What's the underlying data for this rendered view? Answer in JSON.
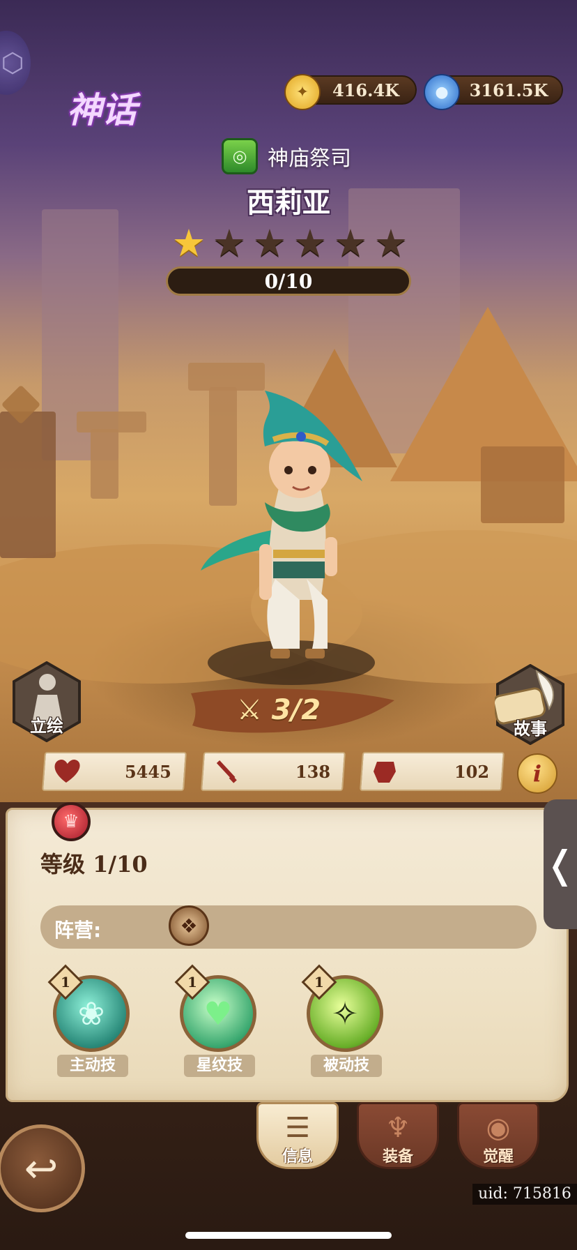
{
  "currencies": {
    "gold": {
      "value": "416.4K",
      "icon": "gold-coin-icon",
      "color": "#f2b830"
    },
    "gems": {
      "value": "3161.5K",
      "icon": "blue-potion-icon",
      "color": "#3a86e0"
    }
  },
  "hero": {
    "rarity": "神话",
    "class_name": "神庙祭司",
    "class_icon": "green-class-icon",
    "name": "西莉亚",
    "stars_filled": 1,
    "stars_total": 6,
    "shard_progress": "0/10",
    "power": "3/2"
  },
  "side_buttons": {
    "portrait_label": "立绘",
    "story_label": "故事"
  },
  "stats": {
    "hp": {
      "icon": "heart-icon",
      "value": "5445"
    },
    "attack": {
      "icon": "sword-icon",
      "value": "138"
    },
    "defense": {
      "icon": "shield-icon",
      "value": "102"
    },
    "info_label": "i"
  },
  "panel": {
    "level_label": "等级",
    "level_value": "1/10",
    "faction_label": "阵营:",
    "skills": [
      {
        "level": "1",
        "name": "主动技",
        "icon": "creature-skill-icon"
      },
      {
        "level": "1",
        "name": "星纹技",
        "icon": "heart-skill-icon"
      },
      {
        "level": "1",
        "name": "被动技",
        "icon": "warrior-skill-icon"
      }
    ],
    "side_tab_glyph": "❬"
  },
  "nav": {
    "tabs": [
      {
        "label": "信息",
        "active": true
      },
      {
        "label": "装备",
        "active": false
      },
      {
        "label": "觉醒",
        "active": false
      }
    ]
  },
  "footer": {
    "uid": "uid: 715816"
  }
}
